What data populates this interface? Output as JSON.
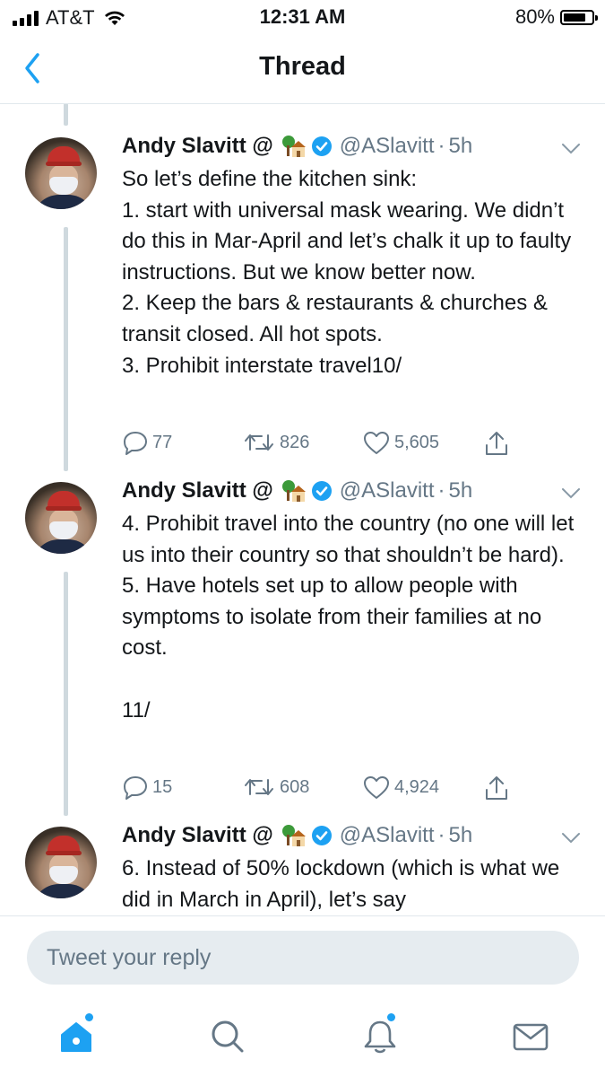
{
  "status_bar": {
    "carrier": "AT&T",
    "time": "12:31 AM",
    "battery": "80%",
    "battery_level": 0.8
  },
  "nav": {
    "title": "Thread",
    "back_icon": "chevron-left-icon"
  },
  "tweets": [
    {
      "name": "Andy Slavitt @",
      "handle": "@ASlavitt",
      "dot": "·",
      "time": "5h",
      "text": "So let’s define the kitchen sink:\n1. start with universal mask wearing. We didn’t do this in Mar-April and let’s chalk it up to faulty instructions. But we know better now.\n2. Keep the bars & restaurants & churches & transit closed. All hot spots.\n3. Prohibit interstate travel10/",
      "replies": "77",
      "retweets": "826",
      "likes": "5,605"
    },
    {
      "name": "Andy Slavitt @",
      "handle": "@ASlavitt",
      "dot": "·",
      "time": "5h",
      "text": "4. Prohibit travel into the country (no one will let us into their country so that shouldn’t be hard).\n5. Have hotels set up to allow people with symptoms to isolate from their families at no cost.\n\n11/",
      "replies": "15",
      "retweets": "608",
      "likes": "4,924"
    },
    {
      "name": "Andy Slavitt @",
      "handle": "@ASlavitt",
      "dot": "·",
      "time": "5h",
      "text": "6. Instead of 50% lockdown (which is what we did in March in April), let’s say"
    }
  ],
  "reply": {
    "placeholder": "Tweet your reply"
  },
  "tabs": [
    {
      "name": "home",
      "icon": "home-icon",
      "active": true,
      "badge": true
    },
    {
      "name": "search",
      "icon": "search-icon",
      "active": false,
      "badge": false
    },
    {
      "name": "notifications",
      "icon": "bell-icon",
      "active": false,
      "badge": true
    },
    {
      "name": "messages",
      "icon": "mail-icon",
      "active": false,
      "badge": false
    }
  ],
  "colors": {
    "accent": "#1da1f2",
    "text": "#14171a",
    "secondary": "#657786",
    "thread_line": "#cfd9de"
  }
}
